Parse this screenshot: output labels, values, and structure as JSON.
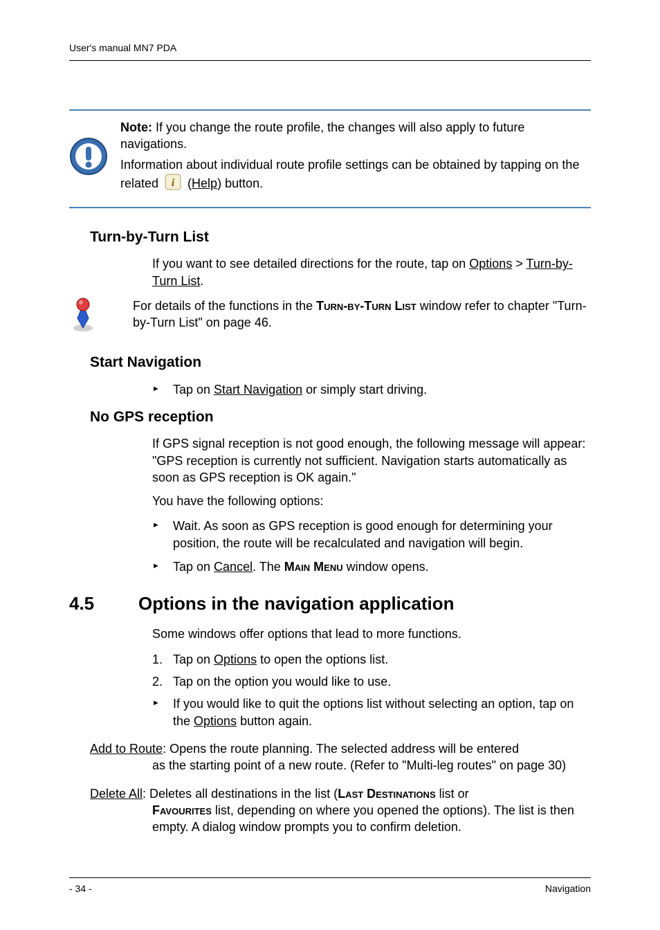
{
  "header": {
    "title": "User's manual MN7 PDA"
  },
  "note": {
    "label": "Note:",
    "p1_rest": " If you change the route profile, the changes will also apply to future navigations.",
    "p2": "Information about individual route profile settings can be obtained by tapping on the related ",
    "help_label": "Help",
    "p2_end": ") button."
  },
  "turn": {
    "heading": "Turn-by-Turn List",
    "p1a": "If you want to see detailed directions for the route, tap on ",
    "options": "Options",
    "gt": " > ",
    "tlist": "Turn-by-Turn List",
    "p1b": ".",
    "info_a": "For details of the functions in the ",
    "info_win": "Turn-by-Turn List",
    "info_b": " window refer to chapter \"Turn-by-Turn List\" on page 46."
  },
  "startnav": {
    "heading": "Start Navigation",
    "li1a": "Tap on ",
    "li1u": "Start Navigation",
    "li1b": " or simply start driving."
  },
  "nogps": {
    "heading": "No GPS reception",
    "p1": "If GPS signal reception is not good enough, the following message will appear: \"GPS reception is currently not sufficient. Navigation starts automatically as soon as GPS reception is OK again.\"",
    "p2": "You have the following options:",
    "li1": "Wait. As soon as GPS reception is good enough for determining your position, the route will be recalculated and navigation will begin.",
    "li2a": "Tap on ",
    "li2u": "Cancel",
    "li2b": ". The ",
    "li2win": "Main Menu",
    "li2c": " window opens."
  },
  "section": {
    "num": "4.5",
    "title": "Options in the navigation application",
    "intro": "Some windows offer options that lead to more functions.",
    "n1a": "Tap on ",
    "n1u": "Options",
    "n1b": " to open the options list.",
    "n2": "Tap on the option you would like to use.",
    "arrowa": "If you would like to quit the options list without selecting an option, tap on the ",
    "arrowu": "Options",
    "arrowb": " button again."
  },
  "defs": {
    "add_label": "Add to Route",
    "add_body": ": Opens the route planning. The selected address will be entered as the starting point of a new route. (Refer to \"Multi-leg routes\" on page 30)",
    "del_label": "Delete All",
    "del_a": ": Deletes all destinations in the list (",
    "del_win1": "Last Destinations",
    "del_b": " list or ",
    "del_win2": "Favourites",
    "del_c": " list, depending on where you opened the options). The list is then empty. A dialog window prompts you to confirm deletion."
  },
  "footer": {
    "page": "- 34 -",
    "section": "Navigation"
  }
}
